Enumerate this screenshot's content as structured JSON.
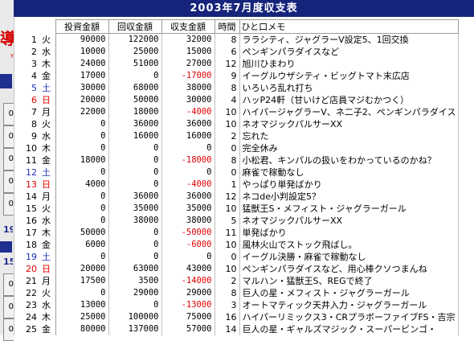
{
  "title": "2003年7月度収支表",
  "left_panel": {
    "logo_char": "導",
    "logo_sub": "Y",
    "buttons": [
      "0",
      "0",
      "0",
      "0",
      "0",
      "0",
      "0",
      "0",
      "0"
    ],
    "tags": [
      "19",
      "15"
    ]
  },
  "columns": {
    "investment": "投資金額",
    "collected": "回収金額",
    "balance": "収支金額",
    "hours": "時間",
    "memo": "ひと口メモ"
  },
  "rows": [
    {
      "day": "1",
      "weekday": "火",
      "type": "weekday",
      "investment": "90000",
      "collected": "122000",
      "balance": "32000",
      "negative": false,
      "hours": "8",
      "memo": "ララシティ、ジャグラーV設定5、1回交換"
    },
    {
      "day": "2",
      "weekday": "水",
      "type": "weekday",
      "investment": "10000",
      "collected": "25000",
      "balance": "15000",
      "negative": false,
      "hours": "6",
      "memo": "ペンギンパラダイスなど"
    },
    {
      "day": "3",
      "weekday": "木",
      "type": "weekday",
      "investment": "24000",
      "collected": "51000",
      "balance": "27000",
      "negative": false,
      "hours": "12",
      "memo": "旭川ひまわり"
    },
    {
      "day": "4",
      "weekday": "金",
      "type": "weekday",
      "investment": "17000",
      "collected": "0",
      "balance": "-17000",
      "negative": true,
      "hours": "9",
      "memo": "イーグルウザシティ・ビッグトマト末広店"
    },
    {
      "day": "5",
      "weekday": "土",
      "type": "saturday",
      "investment": "30000",
      "collected": "68000",
      "balance": "38000",
      "negative": false,
      "hours": "8",
      "memo": "いろいろ乱れ打ち"
    },
    {
      "day": "6",
      "weekday": "日",
      "type": "sunday",
      "investment": "20000",
      "collected": "50000",
      "balance": "30000",
      "negative": false,
      "hours": "4",
      "memo": "ハッP24軒（甘いけど店員マジむかつく）"
    },
    {
      "day": "7",
      "weekday": "月",
      "type": "weekday",
      "investment": "22000",
      "collected": "18000",
      "balance": "-4000",
      "negative": true,
      "hours": "10",
      "memo": "ハイパージャグラーV、ネ二子2、ペンギンパラダイス"
    },
    {
      "day": "8",
      "weekday": "火",
      "type": "weekday",
      "investment": "0",
      "collected": "36000",
      "balance": "36000",
      "negative": false,
      "hours": "10",
      "memo": "ネオマジックパルサーXX"
    },
    {
      "day": "9",
      "weekday": "水",
      "type": "weekday",
      "investment": "0",
      "collected": "16000",
      "balance": "16000",
      "negative": false,
      "hours": "2",
      "memo": "忘れた"
    },
    {
      "day": "10",
      "weekday": "木",
      "type": "weekday",
      "investment": "0",
      "collected": "0",
      "balance": "0",
      "negative": false,
      "hours": "0",
      "memo": "完全休み"
    },
    {
      "day": "11",
      "weekday": "金",
      "type": "weekday",
      "investment": "18000",
      "collected": "0",
      "balance": "-18000",
      "negative": true,
      "hours": "8",
      "memo": "小松君、キンパルの扱いをわかっているのかね？"
    },
    {
      "day": "12",
      "weekday": "土",
      "type": "saturday",
      "investment": "0",
      "collected": "0",
      "balance": "0",
      "negative": false,
      "hours": "0",
      "memo": "麻雀で稼動なし"
    },
    {
      "day": "13",
      "weekday": "日",
      "type": "sunday",
      "investment": "4000",
      "collected": "0",
      "balance": "-4000",
      "negative": true,
      "hours": "1",
      "memo": "やっぱり単発ばかり"
    },
    {
      "day": "14",
      "weekday": "月",
      "type": "weekday",
      "investment": "0",
      "collected": "36000",
      "balance": "36000",
      "negative": false,
      "hours": "12",
      "memo": "ネコde小判設定5？"
    },
    {
      "day": "15",
      "weekday": "火",
      "type": "weekday",
      "investment": "0",
      "collected": "35000",
      "balance": "35000",
      "negative": false,
      "hours": "10",
      "memo": "猛獣王S・メフィスト・ジャグラーガール"
    },
    {
      "day": "16",
      "weekday": "水",
      "type": "weekday",
      "investment": "0",
      "collected": "38000",
      "balance": "38000",
      "negative": false,
      "hours": "5",
      "memo": "ネオマジックパルサーXX"
    },
    {
      "day": "17",
      "weekday": "木",
      "type": "weekday",
      "investment": "50000",
      "collected": "0",
      "balance": "-50000",
      "negative": true,
      "hours": "11",
      "memo": "単発ばかり"
    },
    {
      "day": "18",
      "weekday": "金",
      "type": "weekday",
      "investment": "6000",
      "collected": "0",
      "balance": "-6000",
      "negative": true,
      "hours": "10",
      "memo": "風林火山でストック飛ばし。"
    },
    {
      "day": "19",
      "weekday": "土",
      "type": "saturday",
      "investment": "0",
      "collected": "0",
      "balance": "0",
      "negative": false,
      "hours": "0",
      "memo": "イーグル決勝・麻雀で稼動なし"
    },
    {
      "day": "20",
      "weekday": "日",
      "type": "sunday",
      "investment": "20000",
      "collected": "63000",
      "balance": "43000",
      "negative": false,
      "hours": "10",
      "memo": "ペンギンパラダイスなど、用心棒クソつまんね"
    },
    {
      "day": "21",
      "weekday": "月",
      "type": "weekday",
      "investment": "17500",
      "collected": "3500",
      "balance": "-14000",
      "negative": true,
      "hours": "2",
      "memo": "マルハン・猛獣王S、REGで終了"
    },
    {
      "day": "22",
      "weekday": "火",
      "type": "weekday",
      "investment": "0",
      "collected": "29000",
      "balance": "29000",
      "negative": false,
      "hours": "8",
      "memo": "巨人の星・メフィスト・ジャグラーガール"
    },
    {
      "day": "23",
      "weekday": "水",
      "type": "weekday",
      "investment": "13000",
      "collected": "0",
      "balance": "-13000",
      "negative": true,
      "hours": "3",
      "memo": "オートマティック天井入力・ジャグラーガール"
    },
    {
      "day": "24",
      "weekday": "木",
      "type": "weekday",
      "investment": "25000",
      "collected": "100000",
      "balance": "75000",
      "negative": false,
      "hours": "16",
      "memo": "ハイパーリミックス3・CRプラボーファイブFS・吉宗"
    },
    {
      "day": "25",
      "weekday": "金",
      "type": "weekday",
      "investment": "80000",
      "collected": "137000",
      "balance": "57000",
      "negative": false,
      "hours": "14",
      "memo": "巨人の星・ギャルズマジック・スーパービンゴ・"
    }
  ]
}
